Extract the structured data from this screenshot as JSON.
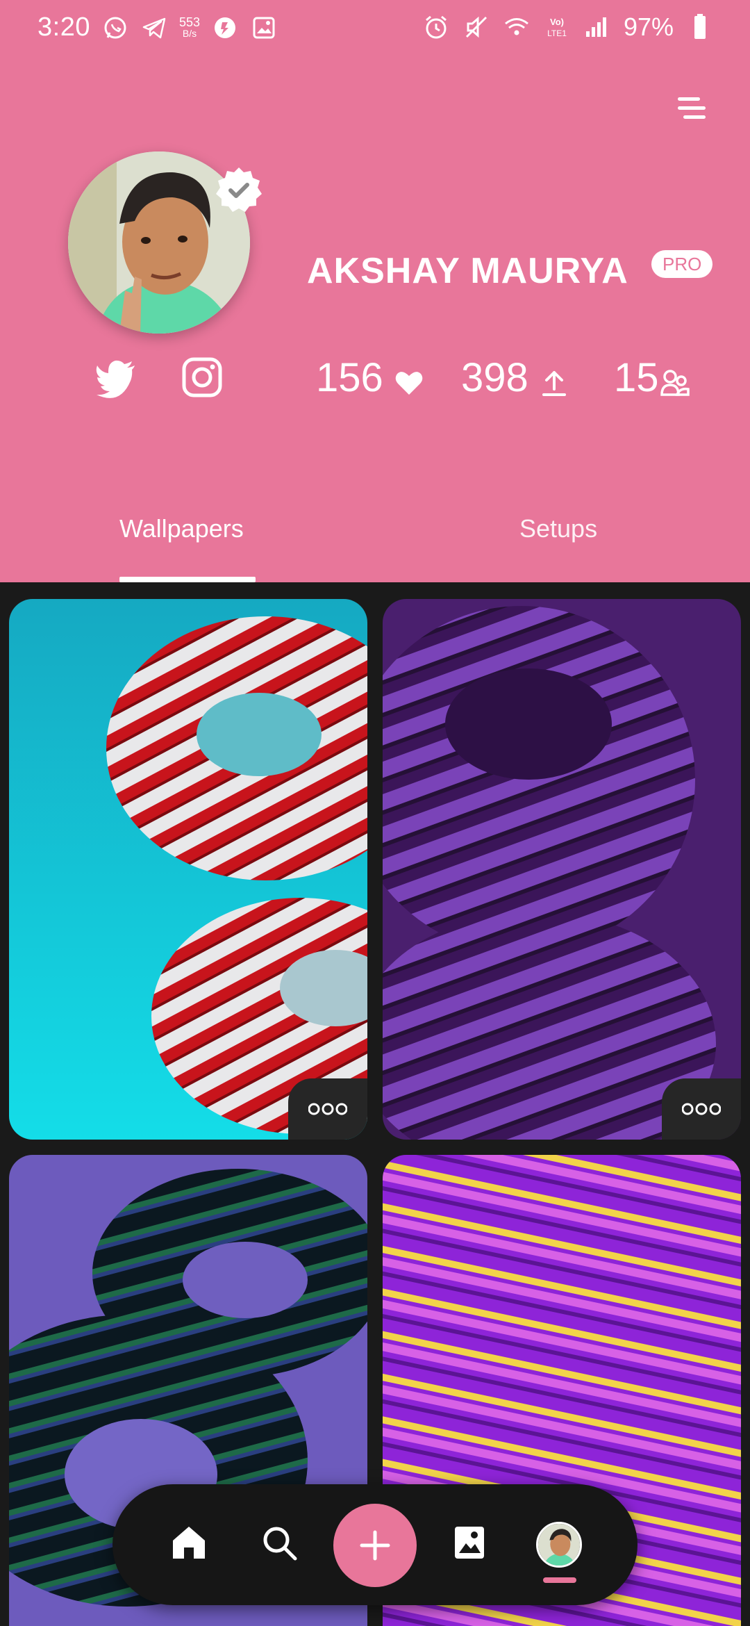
{
  "status_bar": {
    "time": "3:20",
    "net_speed_value": "553",
    "net_speed_unit": "B/s",
    "battery_percent": "97%",
    "left_icons": [
      "whatsapp-icon",
      "telegram-icon",
      "notification-icon",
      "gallery-icon"
    ],
    "right_icons": [
      "alarm-icon",
      "mute-icon",
      "wifi-icon",
      "volte-icon",
      "signal-icon",
      "battery-icon"
    ]
  },
  "profile": {
    "name": "AKSHAY MAURYA",
    "badge": "PRO",
    "verified": true,
    "social": [
      "twitter-icon",
      "instagram-icon"
    ],
    "stats": {
      "likes": "156",
      "uploads": "398",
      "followers": "15"
    }
  },
  "tabs": {
    "wallpapers": "Wallpapers",
    "setups": "Setups",
    "active": "Wallpapers"
  },
  "wallpapers": [
    {
      "colors": [
        "#19c6d6",
        "#c4121a",
        "#e9e9e9"
      ]
    },
    {
      "colors": [
        "#4a1f6e",
        "#6f36a6",
        "#2b0f43"
      ]
    },
    {
      "colors": [
        "#6d5bbd",
        "#0c1d24",
        "#1b6b3c"
      ]
    },
    {
      "colors": [
        "#8e24d8",
        "#f2d34a",
        "#e06ae8"
      ]
    }
  ],
  "bottom_nav": {
    "items": [
      "home-icon",
      "search-icon",
      "add-icon",
      "gallery-icon",
      "profile-avatar"
    ],
    "active": "profile-avatar"
  },
  "theme": {
    "primary": "#e8769a",
    "background": "#1a1a1a"
  }
}
